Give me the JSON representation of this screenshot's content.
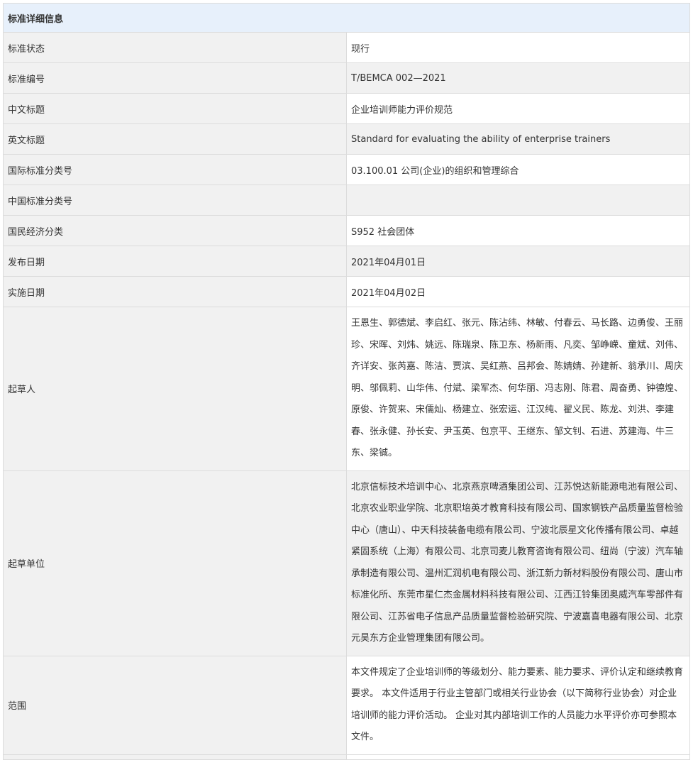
{
  "section_title": "标准详细信息",
  "rows": [
    {
      "label": "标准状态",
      "value": "现行"
    },
    {
      "label": "标准编号",
      "value": "T/BEMCA 002—2021"
    },
    {
      "label": "中文标题",
      "value": "企业培训师能力评价规范"
    },
    {
      "label": "英文标题",
      "value": "Standard for evaluating the ability of enterprise trainers"
    },
    {
      "label": "国际标准分类号",
      "value": "03.100.01 公司(企业)的组织和管理综合"
    },
    {
      "label": "中国标准分类号",
      "value": ""
    },
    {
      "label": "国民经济分类",
      "value": "S952 社会团体"
    },
    {
      "label": "发布日期",
      "value": "2021年04月01日"
    },
    {
      "label": "实施日期",
      "value": "2021年04月02日"
    },
    {
      "label": "起草人",
      "value": "王恩生、郭德斌、李启红、张元、陈沾纬、林敏、付春云、马长路、边勇俊、王丽珍、宋晖、刘炜、姚远、陈瑞泉、陈卫东、杨新雨、凡奕、邹峥嵘、童斌、刘伟、齐详安、张芮嘉、陈洁、贾滨、吴红燕、吕邦会、陈婧婧、孙建新、翁承川、周庆明、邬佩莉、山华伟、付斌、梁军杰、何华丽、冯志刚、陈君、周奋勇、钟德煌、原俊、许贺来、宋儒灿、杨建立、张宏运、江汉纯、翟义民、陈龙、刘洪、李建春、张永健、孙长安、尹玉英、包京平、王继东、邹文钊、石进、苏建海、牛三东、梁铖。"
    },
    {
      "label": "起草单位",
      "value": "北京信标技术培训中心、北京燕京啤酒集团公司、江苏悦达新能源电池有限公司、北京农业职业学院、北京职培英才教育科技有限公司、国家钢铁产品质量监督检验中心（唐山）、中天科技装备电缆有限公司、宁波北辰星文化传播有限公司、卓越紧固系统（上海）有限公司、北京司麦儿教育咨询有限公司、纽尚（宁波）汽车轴承制造有限公司、温州汇润机电有限公司、浙江新力新材料股份有限公司、唐山市标准化所、东莞市星仁杰金属材料科技有限公司、江西江铃集团奥威汽车零部件有限公司、江苏省电子信息产品质量监督检验研究院、宁波嘉喜电器有限公司、北京元昊东方企业管理集团有限公司。"
    },
    {
      "label": "范围",
      "value": "本文件规定了企业培训师的等级划分、能力要素、能力要求、评价认定和继续教育要求。 本文件适用于行业主管部门或相关行业协会（以下简称行业协会）对企业培训师的能力评价活动。 企业对其内部培训工作的人员能力水平评价亦可参照本文件。"
    }
  ]
}
